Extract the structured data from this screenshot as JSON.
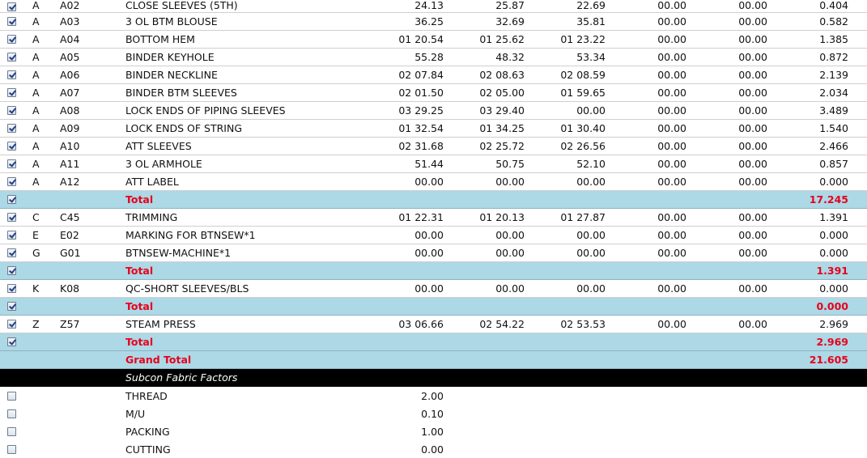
{
  "sections": [
    {
      "rows": [
        {
          "checked": true,
          "sec": "A",
          "code": "A02",
          "desc": "CLOSE SLEEVES (5TH)",
          "v1": "24.13",
          "v2": "25.87",
          "v3": "22.69",
          "v4": "00.00",
          "v5": "00.00",
          "v6": "0.404"
        },
        {
          "checked": true,
          "sec": "A",
          "code": "A03",
          "desc": "3 OL BTM BLOUSE",
          "v1": "36.25",
          "v2": "32.69",
          "v3": "35.81",
          "v4": "00.00",
          "v5": "00.00",
          "v6": "0.582"
        },
        {
          "checked": true,
          "sec": "A",
          "code": "A04",
          "desc": "BOTTOM HEM",
          "v1": "01 20.54",
          "v2": "01 25.62",
          "v3": "01 23.22",
          "v4": "00.00",
          "v5": "00.00",
          "v6": "1.385"
        },
        {
          "checked": true,
          "sec": "A",
          "code": "A05",
          "desc": "BINDER KEYHOLE",
          "v1": "55.28",
          "v2": "48.32",
          "v3": "53.34",
          "v4": "00.00",
          "v5": "00.00",
          "v6": "0.872"
        },
        {
          "checked": true,
          "sec": "A",
          "code": "A06",
          "desc": "BINDER NECKLINE",
          "v1": "02 07.84",
          "v2": "02 08.63",
          "v3": "02 08.59",
          "v4": "00.00",
          "v5": "00.00",
          "v6": "2.139"
        },
        {
          "checked": true,
          "sec": "A",
          "code": "A07",
          "desc": "BINDER BTM SLEEVES",
          "v1": "02 01.50",
          "v2": "02 05.00",
          "v3": "01 59.65",
          "v4": "00.00",
          "v5": "00.00",
          "v6": "2.034"
        },
        {
          "checked": true,
          "sec": "A",
          "code": "A08",
          "desc": "LOCK ENDS OF PIPING SLEEVES",
          "v1": "03 29.25",
          "v2": "03 29.40",
          "v3": "00.00",
          "v4": "00.00",
          "v5": "00.00",
          "v6": "3.489"
        },
        {
          "checked": true,
          "sec": "A",
          "code": "A09",
          "desc": "LOCK ENDS OF STRING",
          "v1": "01 32.54",
          "v2": "01 34.25",
          "v3": "01 30.40",
          "v4": "00.00",
          "v5": "00.00",
          "v6": "1.540"
        },
        {
          "checked": true,
          "sec": "A",
          "code": "A10",
          "desc": "ATT SLEEVES",
          "v1": "02 31.68",
          "v2": "02 25.72",
          "v3": "02 26.56",
          "v4": "00.00",
          "v5": "00.00",
          "v6": "2.466"
        },
        {
          "checked": true,
          "sec": "A",
          "code": "A11",
          "desc": "3 OL ARMHOLE",
          "v1": "51.44",
          "v2": "50.75",
          "v3": "52.10",
          "v4": "00.00",
          "v5": "00.00",
          "v6": "0.857"
        },
        {
          "checked": true,
          "sec": "A",
          "code": "A12",
          "desc": "ATT LABEL",
          "v1": "00.00",
          "v2": "00.00",
          "v3": "00.00",
          "v4": "00.00",
          "v5": "00.00",
          "v6": "0.000"
        }
      ],
      "total": {
        "checked": true,
        "label": "Total",
        "value": "17.245"
      }
    },
    {
      "rows": [
        {
          "checked": true,
          "sec": "C",
          "code": "C45",
          "desc": "TRIMMING",
          "v1": "01 22.31",
          "v2": "01 20.13",
          "v3": "01 27.87",
          "v4": "00.00",
          "v5": "00.00",
          "v6": "1.391"
        },
        {
          "checked": true,
          "sec": "E",
          "code": "E02",
          "desc": "MARKING FOR BTNSEW*1",
          "v1": "00.00",
          "v2": "00.00",
          "v3": "00.00",
          "v4": "00.00",
          "v5": "00.00",
          "v6": "0.000"
        },
        {
          "checked": true,
          "sec": "G",
          "code": "G01",
          "desc": "BTNSEW-MACHINE*1",
          "v1": "00.00",
          "v2": "00.00",
          "v3": "00.00",
          "v4": "00.00",
          "v5": "00.00",
          "v6": "0.000"
        }
      ],
      "total": {
        "checked": true,
        "label": "Total",
        "value": "1.391"
      }
    },
    {
      "rows": [
        {
          "checked": true,
          "sec": "K",
          "code": "K08",
          "desc": "QC-SHORT SLEEVES/BLS",
          "v1": "00.00",
          "v2": "00.00",
          "v3": "00.00",
          "v4": "00.00",
          "v5": "00.00",
          "v6": "0.000"
        }
      ],
      "total": {
        "checked": true,
        "label": "Total",
        "value": "0.000"
      }
    },
    {
      "rows": [
        {
          "checked": true,
          "sec": "Z",
          "code": "Z57",
          "desc": "STEAM PRESS",
          "v1": "03 06.66",
          "v2": "02 54.22",
          "v3": "02 53.53",
          "v4": "00.00",
          "v5": "00.00",
          "v6": "2.969"
        }
      ],
      "total": {
        "checked": true,
        "label": "Total",
        "value": "2.969"
      }
    }
  ],
  "grand_total": {
    "label": "Grand Total",
    "value": "21.605"
  },
  "subcon": {
    "title": "Subcon Fabric Factors",
    "items": [
      {
        "checked": false,
        "label": "THREAD",
        "value": "2.00"
      },
      {
        "checked": false,
        "label": "M/U",
        "value": "0.10"
      },
      {
        "checked": false,
        "label": "PACKING",
        "value": "1.00"
      },
      {
        "checked": false,
        "label": "CUTTING",
        "value": "0.00"
      }
    ]
  },
  "colors": {
    "total_row_bg": "#add8e6",
    "total_text": "#e8001c",
    "header_bg": "#000000"
  }
}
